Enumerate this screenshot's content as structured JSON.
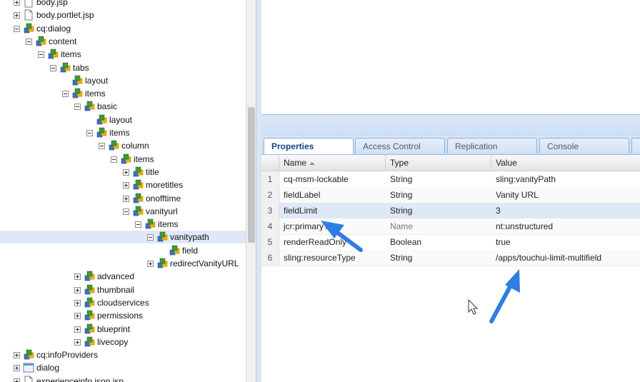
{
  "tree": {
    "nodes": [
      {
        "label": "body.jsp",
        "icon": "file-icon",
        "toggle": "plus"
      },
      {
        "label": "body.portlet.jsp",
        "icon": "file-icon",
        "toggle": "plus"
      },
      {
        "label": "cq:dialog",
        "icon": "node-icon",
        "toggle": "minus"
      },
      {
        "label": "content",
        "icon": "node-icon",
        "toggle": "minus"
      },
      {
        "label": "items",
        "icon": "node-icon",
        "toggle": "minus"
      },
      {
        "label": "tabs",
        "icon": "node-icon",
        "toggle": "minus"
      },
      {
        "label": "layout",
        "icon": "node-icon",
        "toggle": "none"
      },
      {
        "label": "items",
        "icon": "node-icon",
        "toggle": "minus"
      },
      {
        "label": "basic",
        "icon": "node-icon",
        "toggle": "minus"
      },
      {
        "label": "layout",
        "icon": "node-icon",
        "toggle": "none"
      },
      {
        "label": "items",
        "icon": "node-icon",
        "toggle": "minus"
      },
      {
        "label": "column",
        "icon": "node-icon",
        "toggle": "minus"
      },
      {
        "label": "items",
        "icon": "node-icon",
        "toggle": "minus"
      },
      {
        "label": "title",
        "icon": "node-icon",
        "toggle": "plus"
      },
      {
        "label": "moretitles",
        "icon": "node-icon",
        "toggle": "plus"
      },
      {
        "label": "onofftime",
        "icon": "node-icon",
        "toggle": "plus"
      },
      {
        "label": "vanityurl",
        "icon": "node-icon",
        "toggle": "minus"
      },
      {
        "label": "items",
        "icon": "node-icon",
        "toggle": "minus"
      },
      {
        "label": "vanitypath",
        "icon": "node-icon",
        "toggle": "minus",
        "selected": true
      },
      {
        "label": "field",
        "icon": "node-icon",
        "toggle": "none"
      },
      {
        "label": "redirectVanityURL",
        "icon": "node-icon",
        "toggle": "plus"
      },
      {
        "label": "advanced",
        "icon": "node-icon",
        "toggle": "plus"
      },
      {
        "label": "thumbnail",
        "icon": "node-icon",
        "toggle": "plus"
      },
      {
        "label": "cloudservices",
        "icon": "node-icon",
        "toggle": "plus"
      },
      {
        "label": "permissions",
        "icon": "node-icon",
        "toggle": "plus"
      },
      {
        "label": "blueprint",
        "icon": "node-icon",
        "toggle": "plus"
      },
      {
        "label": "livecopy",
        "icon": "node-icon",
        "toggle": "plus"
      },
      {
        "label": "cq:infoProviders",
        "icon": "node-icon",
        "toggle": "plus"
      },
      {
        "label": "dialog",
        "icon": "dialog-icon",
        "toggle": "plus"
      },
      {
        "label": "experienceinfo.json.jsp",
        "icon": "file-icon",
        "toggle": "plus"
      }
    ]
  },
  "tabs": [
    "Properties",
    "Access Control",
    "Replication",
    "Console"
  ],
  "grid": {
    "headers": {
      "name": "Name",
      "type": "Type",
      "value": "Value"
    },
    "rows": [
      {
        "num": "1",
        "name": "cq-msm-lockable",
        "type": "String",
        "value": "sling:vanityPath"
      },
      {
        "num": "2",
        "name": "fieldLabel",
        "type": "String",
        "value": "Vanity URL"
      },
      {
        "num": "3",
        "name": "fieldLimit",
        "type": "String",
        "value": "3"
      },
      {
        "num": "4",
        "name": "jcr:primaryType",
        "type": "Name",
        "value": "nt:unstructured"
      },
      {
        "num": "5",
        "name": "renderReadOnly",
        "type": "Boolean",
        "value": "true"
      },
      {
        "num": "6",
        "name": "sling:resourceType",
        "type": "String",
        "value": "/apps/touchui-limit-multifield"
      }
    ]
  },
  "colors": {
    "accent": "#1a73e8",
    "selection": "#dfe8f6",
    "headerBlue": "#99bbe8"
  }
}
